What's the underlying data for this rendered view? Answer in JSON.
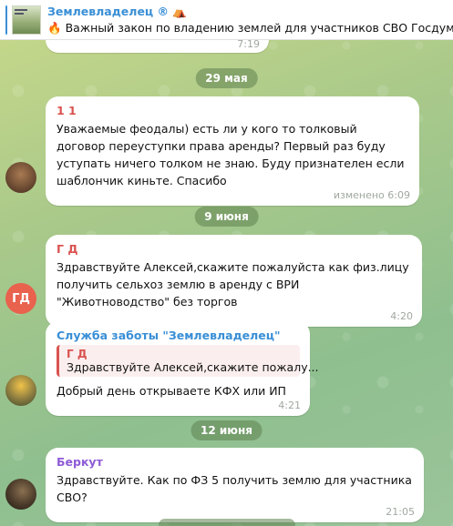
{
  "pinned": {
    "channel_title": "Землевладелец ®",
    "title_icon": "tent-emoji",
    "preview_icon": "fire-emoji",
    "preview_text": "Важный закон по владению землей для участников СВО  Госдума п"
  },
  "top_partial": {
    "time": "7:19"
  },
  "dates": {
    "d1": "29 мая",
    "d2": "9 июня",
    "d3": "12 июня"
  },
  "messages": [
    {
      "author": "1 1",
      "author_color": "#d9534f",
      "text": "Уважаемые феодалы) есть ли у кого то толковый договор переуступки права аренды? Первый раз буду уступать ничего толком не знаю. Буду признателен если шаблончик киньте. Спасибо",
      "time": "изменено 6:09"
    },
    {
      "author": "Г Д",
      "author_color": "#d9534f",
      "avatar_text": "ГД",
      "text": "Здравствуйте Алексей,скажите пожалуйста как физ.лицу получить сельхоз землю в аренду с ВРИ \"Животноводство\" без торгов",
      "time": "4:20"
    },
    {
      "author": "Служба заботы \"Землевладелец\"",
      "author_color": "#3a8fd6",
      "quote_author": "Г Д",
      "quote_text": "Здравствуйте Алексей,скажите пожалу...",
      "text": "Добрый день открываете КФХ или ИП",
      "time": "4:21"
    },
    {
      "author": "Беркут",
      "author_color": "#8e5bd6",
      "text": "Здравствуйте. Как по ФЗ 5 получить землю для участника СВО?",
      "time": "21:05"
    }
  ]
}
